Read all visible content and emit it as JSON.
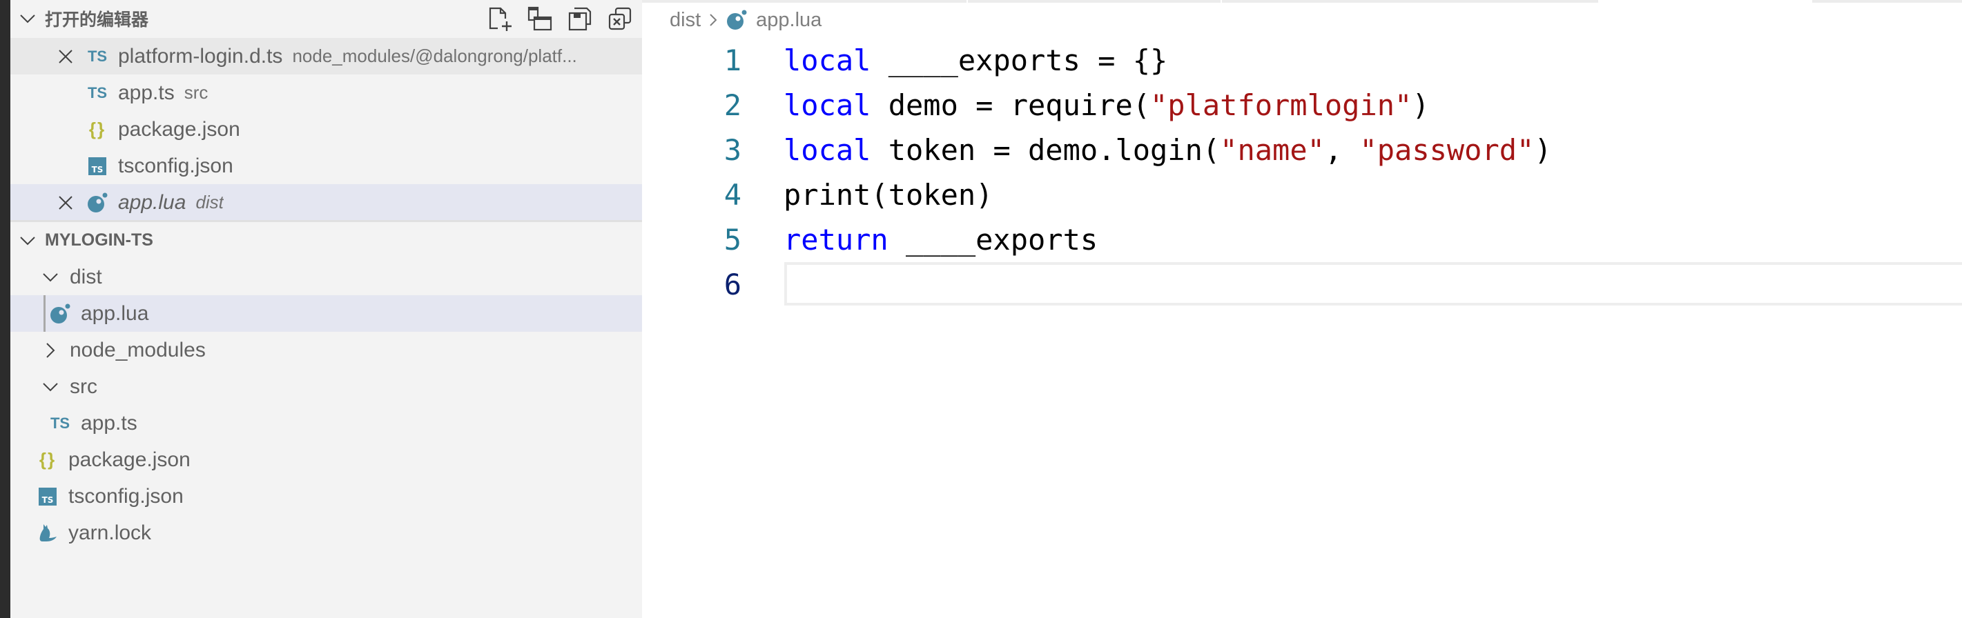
{
  "sidebar": {
    "open_editors": {
      "title": "打开的编辑器",
      "actions": [
        {
          "name": "new-file",
          "label": "New File"
        },
        {
          "name": "toggle-layout",
          "label": "Toggle Vertical/Horizontal Editor Layout"
        },
        {
          "name": "save-all",
          "label": "Save All"
        },
        {
          "name": "close-all",
          "label": "Close All Editors"
        }
      ],
      "items": [
        {
          "name": "platform-login.d.ts",
          "desc": "node_modules/@dalongrong/platf...",
          "icon": "typescript-icon",
          "closable": true,
          "state": "hover"
        },
        {
          "name": "app.ts",
          "desc": "src",
          "icon": "typescript-icon",
          "closable": false,
          "state": ""
        },
        {
          "name": "package.json",
          "desc": "",
          "icon": "json-icon",
          "closable": false,
          "state": ""
        },
        {
          "name": "tsconfig.json",
          "desc": "",
          "icon": "tsconfig-icon",
          "closable": false,
          "state": ""
        },
        {
          "name": "app.lua",
          "desc": "dist",
          "icon": "lua-icon",
          "closable": true,
          "state": "selected",
          "italic": true
        }
      ]
    },
    "explorer": {
      "title": "MYLOGIN-TS",
      "items": [
        {
          "name": "dist",
          "type": "folder",
          "expanded": true,
          "depth": 0
        },
        {
          "name": "app.lua",
          "type": "file",
          "icon": "lua-icon",
          "depth": 1,
          "selected": true
        },
        {
          "name": "node_modules",
          "type": "folder",
          "expanded": false,
          "depth": 0
        },
        {
          "name": "src",
          "type": "folder",
          "expanded": true,
          "depth": 0
        },
        {
          "name": "app.ts",
          "type": "file",
          "icon": "typescript-icon",
          "depth": 1
        },
        {
          "name": "package.json",
          "type": "file",
          "icon": "json-icon",
          "depth": 0
        },
        {
          "name": "tsconfig.json",
          "type": "file",
          "icon": "tsconfig-icon",
          "depth": 0
        },
        {
          "name": "yarn.lock",
          "type": "file",
          "icon": "yarn-icon",
          "depth": 0
        }
      ]
    }
  },
  "editor": {
    "breadcrumb": {
      "folder": "dist",
      "file": "app.lua"
    },
    "current_line": 6,
    "lines": [
      {
        "number": "1",
        "tokens": [
          {
            "t": "local",
            "c": "kw"
          },
          {
            "t": " ____exports = {}",
            "c": ""
          }
        ]
      },
      {
        "number": "2",
        "tokens": [
          {
            "t": "local",
            "c": "kw"
          },
          {
            "t": " demo = require(",
            "c": ""
          },
          {
            "t": "\"platformlogin\"",
            "c": "str"
          },
          {
            "t": ")",
            "c": ""
          }
        ]
      },
      {
        "number": "3",
        "tokens": [
          {
            "t": "local",
            "c": "kw"
          },
          {
            "t": " token = demo.login(",
            "c": ""
          },
          {
            "t": "\"name\"",
            "c": "str"
          },
          {
            "t": ", ",
            "c": ""
          },
          {
            "t": "\"password\"",
            "c": "str"
          },
          {
            "t": ")",
            "c": ""
          }
        ]
      },
      {
        "number": "4",
        "tokens": [
          {
            "t": "print(token)",
            "c": ""
          }
        ]
      },
      {
        "number": "5",
        "tokens": [
          {
            "t": "return",
            "c": "kw"
          },
          {
            "t": " ____exports",
            "c": ""
          }
        ]
      },
      {
        "number": "6",
        "tokens": []
      }
    ]
  },
  "colors": {
    "keyword": "#0000ff",
    "string": "#a31515",
    "line_number": "#237893",
    "line_number_active": "#0b216f",
    "icon_blue": "#498ba7",
    "json_yellow": "#b8b83c",
    "selected_row": "#e4e6f1",
    "hover_row": "#e8e8e8"
  }
}
